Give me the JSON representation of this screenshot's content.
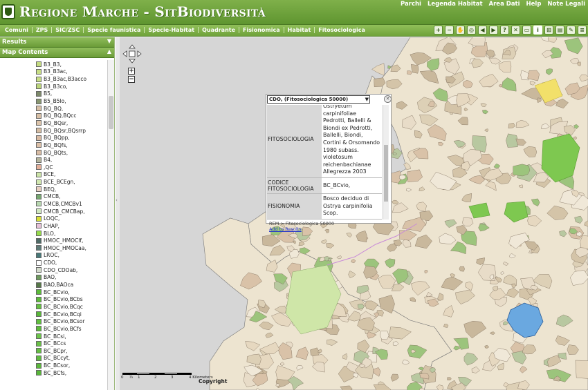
{
  "header": {
    "title": "Regione Marche - SitBiodiversità",
    "links": [
      "Parchi",
      "Legenda Habitat",
      "Area Dati",
      "Help",
      "Note Legali"
    ]
  },
  "menu": {
    "items": [
      "Comuni",
      "ZPS",
      "SIC/ZSC",
      "Specie faunistica",
      "Specie-Habitat",
      "Quadrante",
      "Fisionomica",
      "Habitat",
      "Fitosociologica"
    ]
  },
  "toolbar": {
    "tools": [
      "zoom-in-icon",
      "zoom-out-icon",
      "pan-hand-icon",
      "zoom-full-icon",
      "back-arrow-icon",
      "forward-arrow-icon",
      "query-icon",
      "clear-icon",
      "select-icon",
      "identify-icon",
      "measure-icon",
      "print-icon",
      "edit-icon",
      "layers-icon"
    ]
  },
  "left_panel": {
    "results_label": "Results",
    "map_contents_label": "Map Contents",
    "legend": [
      {
        "label": "B3_B3,",
        "color": "#c4dc80"
      },
      {
        "label": "B3_B3ac,",
        "color": "#c8de86"
      },
      {
        "label": "B3_B3ac,B3acco",
        "color": "#c8de86"
      },
      {
        "label": "B3_B3co,",
        "color": "#bcd67a"
      },
      {
        "label": "B5,",
        "color": "#7d8a6a"
      },
      {
        "label": "B5_B5lo,",
        "color": "#889670"
      },
      {
        "label": "BQ_BQ,",
        "color": "#d8c0a6"
      },
      {
        "label": "BQ_BQ,BQcc",
        "color": "#d8c0a6"
      },
      {
        "label": "BQ_BQsr,",
        "color": "#dcc4aa"
      },
      {
        "label": "BQ_BQsr,BQsrrp",
        "color": "#d4bca2"
      },
      {
        "label": "BQ_BQpp,",
        "color": "#d8baa2"
      },
      {
        "label": "BQ_BQfs,",
        "color": "#dcc0a8"
      },
      {
        "label": "BQ_BQts,",
        "color": "#d8bca4"
      },
      {
        "label": "B4,",
        "color": "#b4b49c"
      },
      {
        "label": ",QC",
        "color": "#e4b09a"
      },
      {
        "label": "BCE,",
        "color": "#cce4a8"
      },
      {
        "label": "BCE_BCEgn,",
        "color": "#d2e8b0"
      },
      {
        "label": "BEQ,",
        "color": "#e8cfc0"
      },
      {
        "label": "CMCB,",
        "color": "#76a870"
      },
      {
        "label": "CMCB,CMCBv1",
        "color": "#b8d8b0"
      },
      {
        "label": "CMCB_CMCBap,",
        "color": "#d0e8c0"
      },
      {
        "label": "LOQC,",
        "color": "#d8e034"
      },
      {
        "label": "CHAP,",
        "color": "#e6c2d8"
      },
      {
        "label": "BLO,",
        "color": "#96dc4a"
      },
      {
        "label": "HMOC_HMOClf,",
        "color": "#4e6a66"
      },
      {
        "label": "HMOC_HMOCaa,",
        "color": "#5e7a76"
      },
      {
        "label": "LROC,",
        "color": "#487878"
      },
      {
        "label": "CDO,",
        "color": "#ffffff"
      },
      {
        "label": "CDO_CDOab,",
        "color": "#d4dccc"
      },
      {
        "label": "BAO,",
        "color": "#6e9a5e"
      },
      {
        "label": "BAO,BAOca",
        "color": "#567848"
      },
      {
        "label": "BC_BCvio,",
        "color": "#5cbc3a"
      },
      {
        "label": "BC_BCvio,BCbs",
        "color": "#5cbc3a"
      },
      {
        "label": "BC_BCvio,BCqc",
        "color": "#64c040"
      },
      {
        "label": "BC_BCvio,BCqi",
        "color": "#58b838"
      },
      {
        "label": "BC_BCvio,BCsor",
        "color": "#60c03e"
      },
      {
        "label": "BC_BCvio,BCfs",
        "color": "#5cbc3a"
      },
      {
        "label": "BC_BCsi,",
        "color": "#6cc44a"
      },
      {
        "label": "BC_BCcs",
        "color": "#68c046"
      },
      {
        "label": "BC_BCpr,",
        "color": "#64be42"
      },
      {
        "label": "BC_BCcyt,",
        "color": "#60ba40"
      },
      {
        "label": "BC_BCsor,",
        "color": "#5cb83c"
      },
      {
        "label": "BC_BCfs,",
        "color": "#58b63a"
      }
    ]
  },
  "popup": {
    "layer_select": "CDO, (Fitosociologica 50000)",
    "rows": [
      {
        "key": "FITOSOCIOLOGIA",
        "value": "Ostryetum carpinifoliae Pedrotti, Ballelli & Biondi ex Pedrotti, Ballelli, Biondi, Cortini & Orsomando 1980 subass. violetosum reichenbachianae Allegrezza 2003"
      },
      {
        "key": "CODICE FITOSOCIOLOGIA",
        "value": "BC_BCvio,"
      },
      {
        "key": "FISIONOMIA",
        "value": "Bosco deciduo di Ostrya carpinifolia Scop."
      }
    ],
    "footer_path": "REM > Fitosociologica 50000",
    "add_to_results": "Add to Results"
  },
  "map": {
    "scale_ticks": [
      "0",
      "½",
      "1",
      "2",
      "3",
      "4 Kilometers"
    ],
    "copyright": "Copyright",
    "colors": {
      "background": "#d6d6d6",
      "land": "#ede4d0",
      "forest": "#7ec850",
      "lake": "#6aa8e0"
    }
  }
}
